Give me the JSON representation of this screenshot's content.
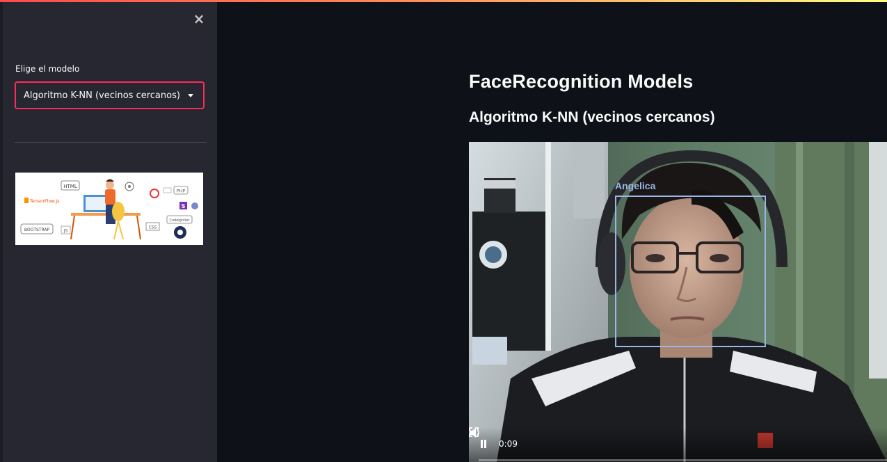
{
  "sidebar": {
    "close_icon": "×",
    "select_label": "Elige el modelo",
    "select_value": "Algoritmo K-NN (vecinos cercanos)",
    "banner_texts": [
      "HTML",
      "TensorFlow.js",
      "PHP",
      "BOOTSTRAP",
      "CSS",
      "Codeigniter",
      "JS",
      "S"
    ]
  },
  "main": {
    "title": "FaceRecognition Models",
    "subtitle": "Algoritmo K-NN (vecinos cercanos)",
    "video": {
      "face_label": "Angelica",
      "time": "0:09"
    }
  },
  "colors": {
    "accent": "#ff2b58",
    "sidebar_bg": "#262730",
    "main_bg": "#0e1117",
    "face_box": "#9bb6e6"
  },
  "icons": [
    "close-icon",
    "chevron-down-icon",
    "pause-icon",
    "volume-icon",
    "fullscreen-icon"
  ]
}
